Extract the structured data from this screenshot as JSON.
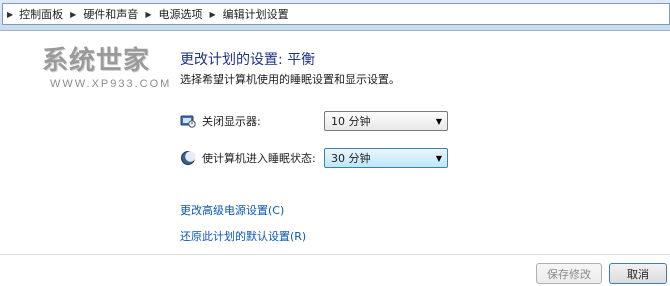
{
  "breadcrumb": {
    "items": [
      "控制面板",
      "硬件和声音",
      "电源选项",
      "编辑计划设置"
    ]
  },
  "watermark": {
    "main": "系统世家",
    "sub": "WWW.XP933.COM"
  },
  "page": {
    "title": "更改计划的设置: 平衡",
    "subtitle": "选择希望计算机使用的睡眠设置和显示设置。"
  },
  "settings": {
    "display_off": {
      "label": "关闭显示器:",
      "value": "10 分钟",
      "icon": "monitor-power-icon"
    },
    "sleep": {
      "label": "使计算机进入睡眠状态:",
      "value": "30 分钟",
      "icon": "moon-sleep-icon"
    }
  },
  "links": {
    "advanced": "更改高级电源设置(C)",
    "restore": "还原此计划的默认设置(R)"
  },
  "buttons": {
    "save": "保存修改",
    "cancel": "取消"
  },
  "colors": {
    "heading": "#1e3287",
    "link": "#0b57b5"
  }
}
